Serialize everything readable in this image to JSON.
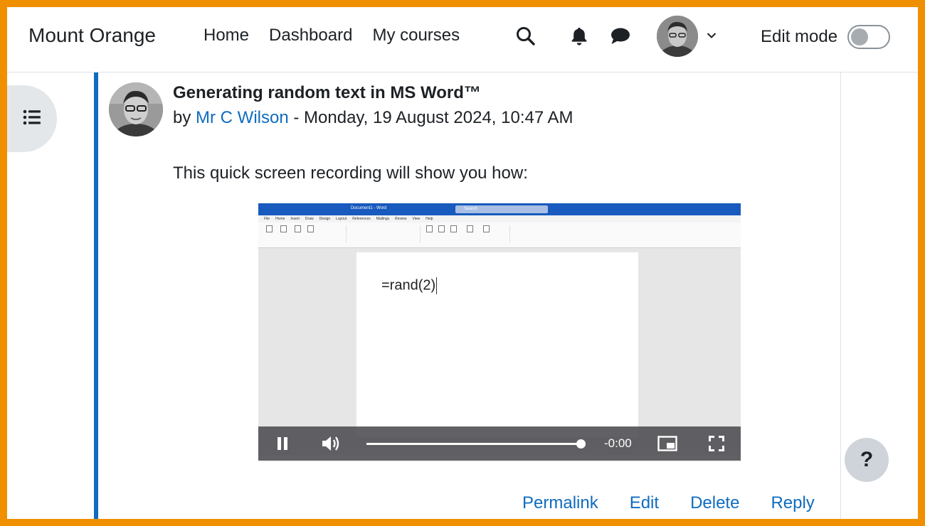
{
  "navbar": {
    "brand": "Mount Orange",
    "links": [
      "Home",
      "Dashboard",
      "My courses"
    ],
    "edit_mode_label": "Edit mode"
  },
  "post": {
    "title": "Generating random text in MS Word™",
    "by_prefix": "by",
    "author": "Mr C Wilson",
    "date": " - Monday, 19 August 2024, 10:47 AM",
    "body": "This quick screen recording will show you how:"
  },
  "video": {
    "word_text": "=rand(2)",
    "time": "-0:00",
    "progress": 1.0,
    "word_title": "Document1 - Word",
    "word_search": "Search",
    "word_tabs": [
      "File",
      "Home",
      "Insert",
      "Draw",
      "Design",
      "Layout",
      "References",
      "Mailings",
      "Review",
      "View",
      "Help"
    ]
  },
  "actions": [
    "Permalink",
    "Edit",
    "Delete",
    "Reply"
  ],
  "help_label": "?",
  "colors": {
    "accent": "#0f6cbf",
    "border": "#f09000"
  },
  "icons": [
    "search-icon",
    "bell-icon",
    "chat-icon",
    "chevron-down-icon",
    "list-icon",
    "pause-icon",
    "volume-icon",
    "pip-icon",
    "fullscreen-icon"
  ]
}
